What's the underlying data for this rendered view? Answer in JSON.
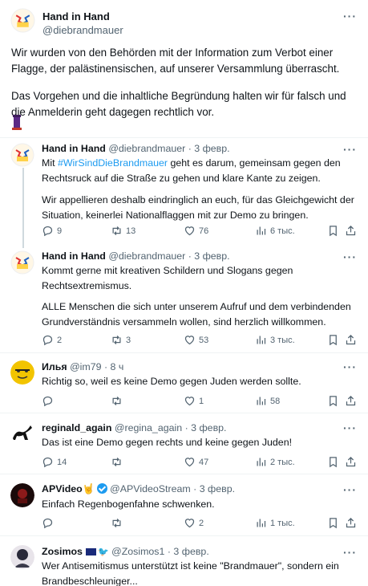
{
  "main_post": {
    "author_name": "Hand in Hand",
    "author_handle": "@diebrandmauer",
    "paragraphs": [
      "Wir wurden von den Behörden mit der Information zum Verbot einer Flagge, der palästinensischen, auf unserer Versammlung überrascht.",
      "Das Vorgehen und die inhaltliche Begründung halten wir für falsch und die Anmelderin geht dagegen rechtlich vor."
    ],
    "emoji": "tower-emoji",
    "more": "···"
  },
  "posts": [
    {
      "name": "Hand in Hand",
      "handle": "@diebrandmauer",
      "sep": " · ",
      "time": "3 февр.",
      "text_pre": "Mit ",
      "hashtag": "#WirSindDieBrandmauer",
      "text_post": " geht es darum, gemeinsam gegen den Rechtsruck auf die Straße zu gehen und klare Kante zu zeigen.",
      "text2": "Wir appellieren deshalb eindringlich an euch, für das Gleichgewicht der Situation, keinerlei Nationalflaggen mit zur Demo zu bringen.",
      "replies": "9",
      "reposts": "13",
      "likes": "76",
      "views": "6 тыс."
    },
    {
      "name": "Hand in Hand",
      "handle": "@diebrandmauer",
      "sep": " · ",
      "time": "3 февр.",
      "text": "Kommt gerne mit kreativen Schildern und Slogans gegen Rechtsextremismus.",
      "text2": "ALLE Menschen die sich unter unserem Aufruf  und dem verbindenden Grundverständnis versammeln wollen, sind herzlich willkommen.",
      "replies": "2",
      "reposts": "3",
      "likes": "53",
      "views": "3 тыс."
    },
    {
      "name": "Илья",
      "handle": "@im79",
      "sep": " · ",
      "time": "8 ч",
      "text": "Richtig so, weil es keine Demo gegen Juden werden sollte.",
      "replies": "",
      "reposts": "",
      "likes": "1",
      "views": "58"
    },
    {
      "name": "reginald_again",
      "handle": "@regina_again",
      "sep": " · ",
      "time": "3 февр.",
      "text": "Das ist eine Demo gegen rechts und keine gegen Juden!",
      "replies": "14",
      "reposts": "",
      "likes": "47",
      "views": "2 тыс."
    },
    {
      "name": "APVideo",
      "hand_emoji": "🤘",
      "handle": "@APVideoStream",
      "sep": " · ",
      "time": "3 февр.",
      "text": "Einfach Regenbogenfahne schwenken.",
      "replies": "",
      "reposts": "",
      "likes": "2",
      "views": "1 тыс."
    },
    {
      "name": "Zosimos",
      "handle": "@Zosimos1",
      "sep": " · ",
      "time": "3 февр.",
      "text": "Wer Antisemitismus unterstützt ist keine \"Brandmauer\", sondern ein Brandbeschleuniger..."
    }
  ],
  "more_label": "···",
  "colors": {
    "text": "#0f1419",
    "secondary": "#536471",
    "link": "#1d9bf0",
    "divider": "#eff3f4"
  }
}
